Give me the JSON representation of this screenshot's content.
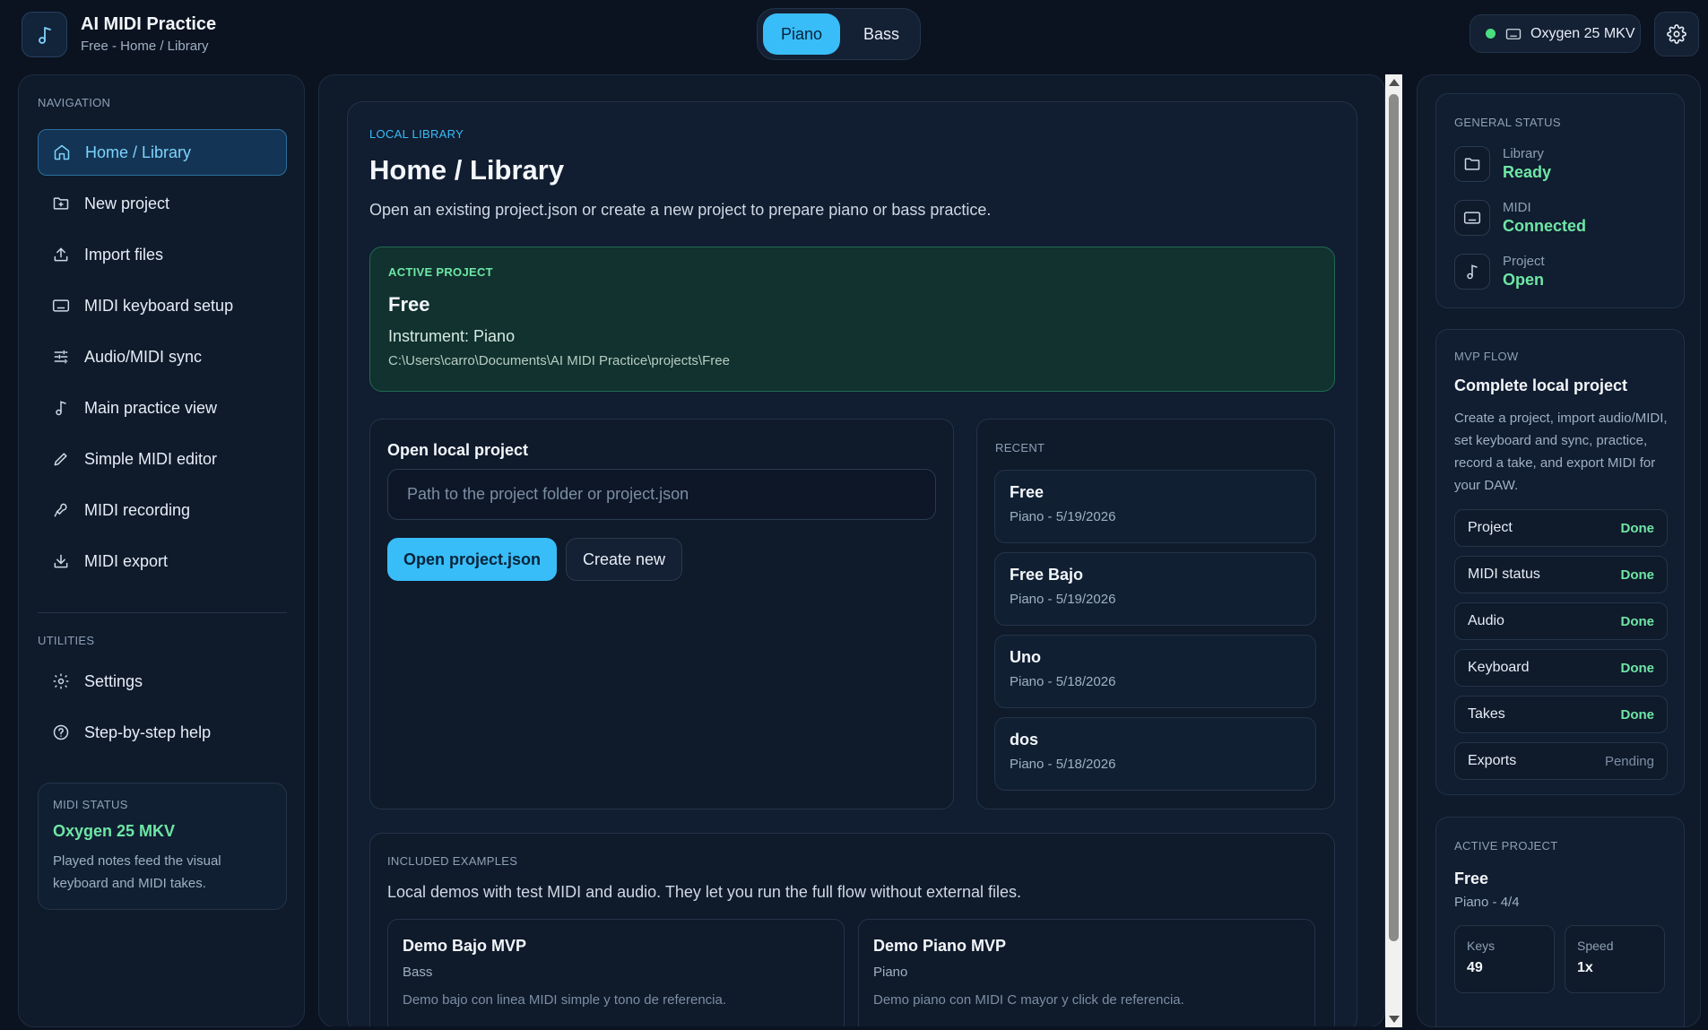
{
  "app": {
    "title": "AI MIDI Practice",
    "subtitle": "Free - Home / Library"
  },
  "instrument_toggle": {
    "piano": "Piano",
    "bass": "Bass",
    "selected": "Piano"
  },
  "device": {
    "name": "Oxygen 25 MKV",
    "status_color": "#4ade80"
  },
  "sidebar": {
    "nav_label": "NAVIGATION",
    "items": [
      {
        "label": "Home / Library",
        "icon": "home-icon",
        "active": true
      },
      {
        "label": "New project",
        "icon": "folder-plus-icon"
      },
      {
        "label": "Import files",
        "icon": "upload-icon"
      },
      {
        "label": "MIDI keyboard setup",
        "icon": "keyboard-icon"
      },
      {
        "label": "Audio/MIDI sync",
        "icon": "sliders-icon"
      },
      {
        "label": "Main practice view",
        "icon": "music-note-icon"
      },
      {
        "label": "Simple MIDI editor",
        "icon": "pencil-icon"
      },
      {
        "label": "MIDI recording",
        "icon": "mic-icon"
      },
      {
        "label": "MIDI export",
        "icon": "download-icon"
      }
    ],
    "utilities_label": "UTILITIES",
    "utilities": [
      {
        "label": "Settings",
        "icon": "gear-icon"
      },
      {
        "label": "Step-by-step help",
        "icon": "help-icon"
      }
    ],
    "midi_status": {
      "label": "MIDI STATUS",
      "device": "Oxygen 25 MKV",
      "desc": "Played notes feed the visual keyboard and MIDI takes."
    }
  },
  "main": {
    "eyebrow": "LOCAL LIBRARY",
    "title": "Home / Library",
    "description": "Open an existing project.json or create a new project to prepare piano or bass practice.",
    "active_project": {
      "label": "ACTIVE PROJECT",
      "name": "Free",
      "instrument": "Instrument: Piano",
      "path": "C:\\Users\\carro\\Documents\\AI MIDI Practice\\projects\\Free"
    },
    "open_local": {
      "title": "Open local project",
      "placeholder": "Path to the project folder or project.json",
      "open_button": "Open project.json",
      "create_button": "Create new"
    },
    "recent": {
      "label": "RECENT",
      "items": [
        {
          "name": "Free",
          "meta": "Piano - 5/19/2026"
        },
        {
          "name": "Free Bajo",
          "meta": "Piano - 5/19/2026"
        },
        {
          "name": "Uno",
          "meta": "Piano - 5/18/2026"
        },
        {
          "name": "dos",
          "meta": "Piano - 5/18/2026"
        }
      ]
    },
    "examples": {
      "label": "INCLUDED EXAMPLES",
      "description": "Local demos with test MIDI and audio. They let you run the full flow without external files.",
      "items": [
        {
          "name": "Demo Bajo MVP",
          "instrument": "Bass",
          "desc": "Demo bajo con linea MIDI simple y tono de referencia."
        },
        {
          "name": "Demo Piano MVP",
          "instrument": "Piano",
          "desc": "Demo piano con MIDI C mayor y click de referencia."
        }
      ]
    }
  },
  "right": {
    "general_status": {
      "label": "GENERAL STATUS",
      "rows": [
        {
          "key": "Library",
          "value": "Ready",
          "icon": "folder-icon"
        },
        {
          "key": "MIDI",
          "value": "Connected",
          "icon": "keyboard-icon"
        },
        {
          "key": "Project",
          "value": "Open",
          "icon": "music-note-icon"
        }
      ]
    },
    "mvp_flow": {
      "label": "MVP FLOW",
      "title": "Complete local project",
      "desc": "Create a project, import audio/MIDI, set keyboard and sync, practice, record a take, and export MIDI for your DAW.",
      "steps": [
        {
          "name": "Project",
          "status": "Done"
        },
        {
          "name": "MIDI status",
          "status": "Done"
        },
        {
          "name": "Audio",
          "status": "Done"
        },
        {
          "name": "Keyboard",
          "status": "Done"
        },
        {
          "name": "Takes",
          "status": "Done"
        },
        {
          "name": "Exports",
          "status": "Pending"
        }
      ]
    },
    "active_project": {
      "label": "ACTIVE PROJECT",
      "name": "Free",
      "meta": "Piano - 4/4",
      "stats": [
        {
          "key": "Keys",
          "value": "49"
        },
        {
          "key": "Speed",
          "value": "1x"
        }
      ]
    }
  }
}
